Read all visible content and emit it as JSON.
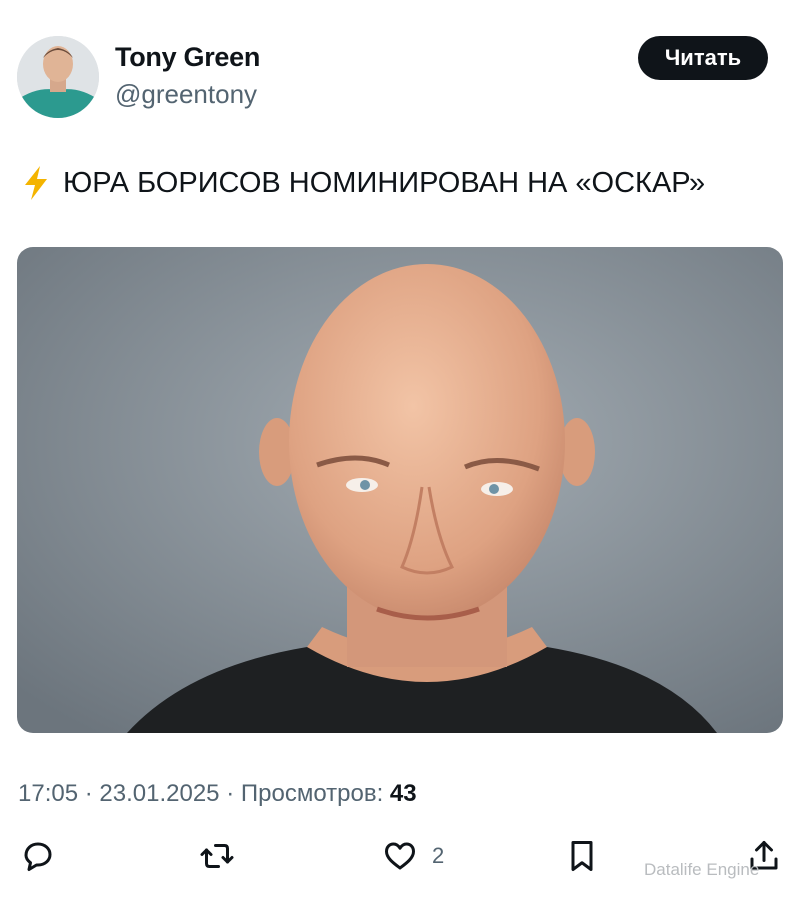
{
  "author": {
    "name": "Tony Green",
    "handle": "@greentony"
  },
  "header": {
    "read_button_label": "Читать"
  },
  "tweet": {
    "emoji": "⚡",
    "text": "ЮРА БОРИСОВ НОМИНИРОВАН НА «ОСКАР»"
  },
  "meta": {
    "time": "17:05",
    "separator": "·",
    "date": "23.01.2025",
    "views_label": "Просмотров:",
    "views_count": "43"
  },
  "actions": {
    "reply_icon": "reply-icon",
    "retweet_icon": "retweet-icon",
    "like_icon": "heart-icon",
    "like_count": "2",
    "bookmark_icon": "bookmark-icon",
    "share_icon": "share-icon"
  },
  "watermark": "Datalife Engine",
  "colors": {
    "text_primary": "#0f1419",
    "text_secondary": "#536471",
    "button_bg": "#0f1419",
    "lightning": "#f4b400"
  }
}
